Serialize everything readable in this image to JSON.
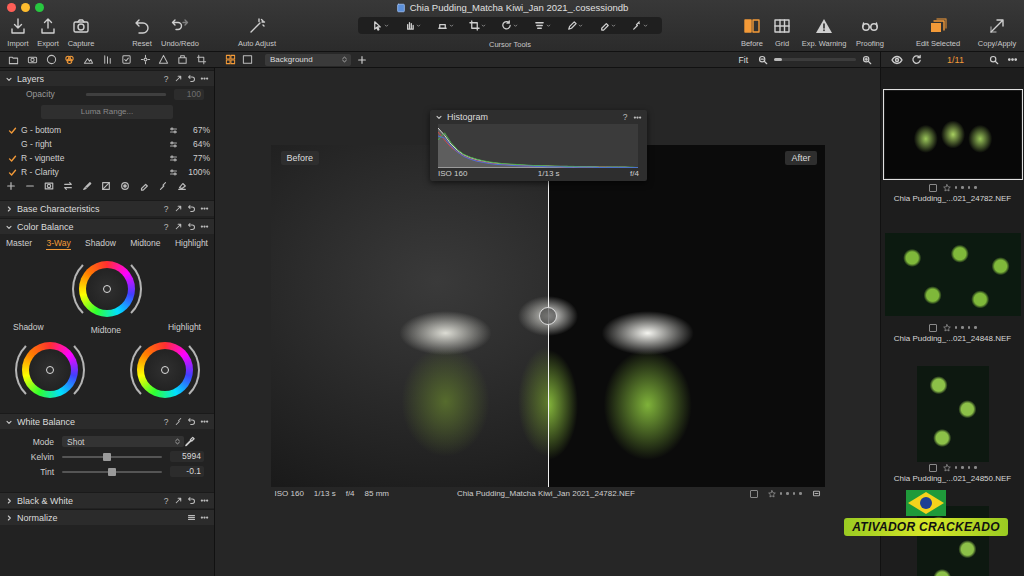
{
  "window": {
    "title": "Chia Pudding_Matcha Kiwi_Jan 2021_.cosessiondb"
  },
  "toolbar": {
    "left": [
      {
        "label": "Import",
        "active": false
      },
      {
        "label": "Export",
        "active": false
      },
      {
        "label": "Capture",
        "active": false
      },
      {
        "label": "Reset",
        "active": false
      },
      {
        "label": "Undo/Redo",
        "active": false
      },
      {
        "label": "Auto Adjust",
        "active": false
      }
    ],
    "cursor_tools": {
      "label": "Cursor Tools"
    },
    "right": [
      {
        "label": "Before",
        "active": true
      },
      {
        "label": "Grid",
        "active": false
      },
      {
        "label": "Exp. Warning",
        "active": false
      },
      {
        "label": "Proofing",
        "active": false
      },
      {
        "label": "Edit Selected",
        "active": true
      },
      {
        "label": "Copy/Apply",
        "active": false
      }
    ]
  },
  "tool_tabs": [
    {
      "selected": false
    },
    {
      "selected": false
    },
    {
      "selected": false
    },
    {
      "selected": true
    },
    {
      "selected": false
    },
    {
      "selected": false
    },
    {
      "selected": false
    },
    {
      "selected": false
    },
    {
      "selected": false
    },
    {
      "selected": false
    },
    {
      "selected": false
    }
  ],
  "viewer_bar": {
    "view_modes": [
      {
        "selected": true
      },
      {
        "selected": false
      }
    ],
    "background": "Background",
    "zoom": {
      "label": "Fit",
      "level": 0.1
    }
  },
  "browser_bar": {
    "counter": "1/11"
  },
  "layers": {
    "title": "Layers",
    "help": "?",
    "expanded": true,
    "opacity": {
      "label": "Opacity",
      "value": "100",
      "level": 1
    },
    "luma_range": "Luma Range...",
    "items": [
      {
        "name": "G - bottom",
        "checked": true,
        "value": "67%"
      },
      {
        "name": "G - right",
        "checked": false,
        "value": "64%"
      },
      {
        "name": "R - vignette",
        "checked": true,
        "value": "77%"
      },
      {
        "name": "R - Clarity",
        "checked": true,
        "value": "100%"
      }
    ]
  },
  "base_characteristics": {
    "title": "Base Characteristics",
    "help": "?",
    "expanded": false
  },
  "color_balance": {
    "title": "Color Balance",
    "help": "?",
    "expanded": true,
    "tabs": [
      {
        "label": "Master",
        "selected": false
      },
      {
        "label": "3-Way",
        "selected": true
      },
      {
        "label": "Shadow",
        "selected": false
      },
      {
        "label": "Midtone",
        "selected": false
      },
      {
        "label": "Highlight",
        "selected": false
      }
    ],
    "wheels": [
      {
        "label": "Shadow"
      },
      {
        "label": "Midtone"
      },
      {
        "label": "Highlight"
      }
    ]
  },
  "white_balance": {
    "title": "White Balance",
    "help": "?",
    "expanded": true,
    "mode": {
      "label": "Mode",
      "value": "Shot"
    },
    "kelvin": {
      "label": "Kelvin",
      "value": "5994",
      "level": 0.45
    },
    "tint": {
      "label": "Tint",
      "value": "-0.1",
      "level": 0.5
    }
  },
  "black_white": {
    "title": "Black & White",
    "help": "?",
    "expanded": false
  },
  "normalize": {
    "title": "Normalize",
    "expanded": false
  },
  "viewer": {
    "before_label": "Before",
    "after_label": "After",
    "split": 0.5,
    "info": {
      "iso": "ISO 160",
      "shutter": "1/13 s",
      "aperture": "f/4",
      "focal": "85 mm",
      "file": "Chia Pudding_Matcha Kiwi_Jan 2021_24782.NEF",
      "checked": false,
      "stars": 0
    }
  },
  "histogram": {
    "title": "Histogram",
    "help": "?",
    "expanded": true,
    "iso": "ISO 160",
    "shutter": "1/13 s",
    "aperture": "f/4",
    "series": [
      {
        "color": "#d8d8d8",
        "values": [
          100,
          82,
          60,
          44,
          33,
          26,
          21,
          17,
          14,
          12,
          10,
          9,
          8,
          7,
          6,
          6,
          5,
          5,
          4,
          4,
          4,
          3,
          3,
          3,
          3,
          2,
          2,
          2,
          2,
          2,
          1,
          1
        ]
      },
      {
        "color": "#d04848",
        "values": [
          90,
          70,
          52,
          40,
          30,
          23,
          18,
          15,
          12,
          10,
          9,
          8,
          7,
          6,
          5,
          5,
          4,
          4,
          4,
          3,
          3,
          3,
          2,
          2,
          2,
          2,
          2,
          1,
          1,
          1,
          1,
          1
        ]
      },
      {
        "color": "#4cae4c",
        "values": [
          70,
          88,
          64,
          46,
          34,
          27,
          22,
          18,
          15,
          13,
          11,
          10,
          9,
          8,
          7,
          6,
          6,
          5,
          5,
          4,
          4,
          4,
          3,
          3,
          3,
          2,
          2,
          2,
          2,
          2,
          2,
          1
        ]
      },
      {
        "color": "#4a6fd8",
        "values": [
          80,
          75,
          55,
          40,
          29,
          22,
          17,
          14,
          11,
          9,
          8,
          7,
          6,
          5,
          5,
          4,
          4,
          3,
          3,
          3,
          2,
          2,
          2,
          2,
          2,
          1,
          1,
          1,
          1,
          1,
          1,
          1
        ]
      }
    ]
  },
  "browser": {
    "thumbnails": [
      {
        "label": "Chia Pudding_...021_24782.NEF",
        "selected": true,
        "checked": false,
        "stars": 0
      },
      {
        "label": "Chia Pudding_...021_24848.NEF",
        "selected": false,
        "checked": false,
        "stars": 0
      },
      {
        "label": "Chia Pudding_...021_24850.NEF",
        "selected": false,
        "checked": false,
        "stars": 0
      }
    ]
  },
  "watermark": {
    "text": "ATIVADOR CRACKEADO"
  }
}
